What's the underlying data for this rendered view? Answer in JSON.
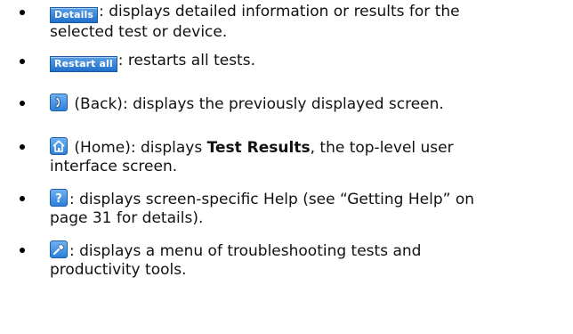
{
  "items": [
    {
      "lines": [
        {
          "button": "Details",
          "text": ": displays detailed information or results for the"
        },
        {
          "text": "selected test or device."
        }
      ]
    },
    {
      "lines": [
        {
          "button": "Restart all",
          "text": ": restarts all tests."
        }
      ]
    },
    {
      "icon": "back-icon",
      "lines": [
        {
          "text": " (Back): displays the previously displayed screen."
        }
      ]
    },
    {
      "icon": "home-icon",
      "lines": [
        {
          "pre": " (Home): displays ",
          "bold": "Test Results",
          "post": ", the top-level user"
        },
        {
          "text": "interface screen."
        }
      ]
    },
    {
      "icon": "help-icon",
      "lines": [
        {
          "text": ": displays screen-specific Help (see “Getting Help” on"
        },
        {
          "text": "page 31 for details)."
        }
      ]
    },
    {
      "icon": "tools-icon",
      "lines": [
        {
          "text": ": displays a menu of troubleshooting tests and"
        },
        {
          "text": "productivity tools."
        }
      ]
    }
  ],
  "colors": {
    "button_gradient_top": "#5aa0e6",
    "button_gradient_bottom": "#1f6fcc",
    "button_text": "#ffffff"
  }
}
